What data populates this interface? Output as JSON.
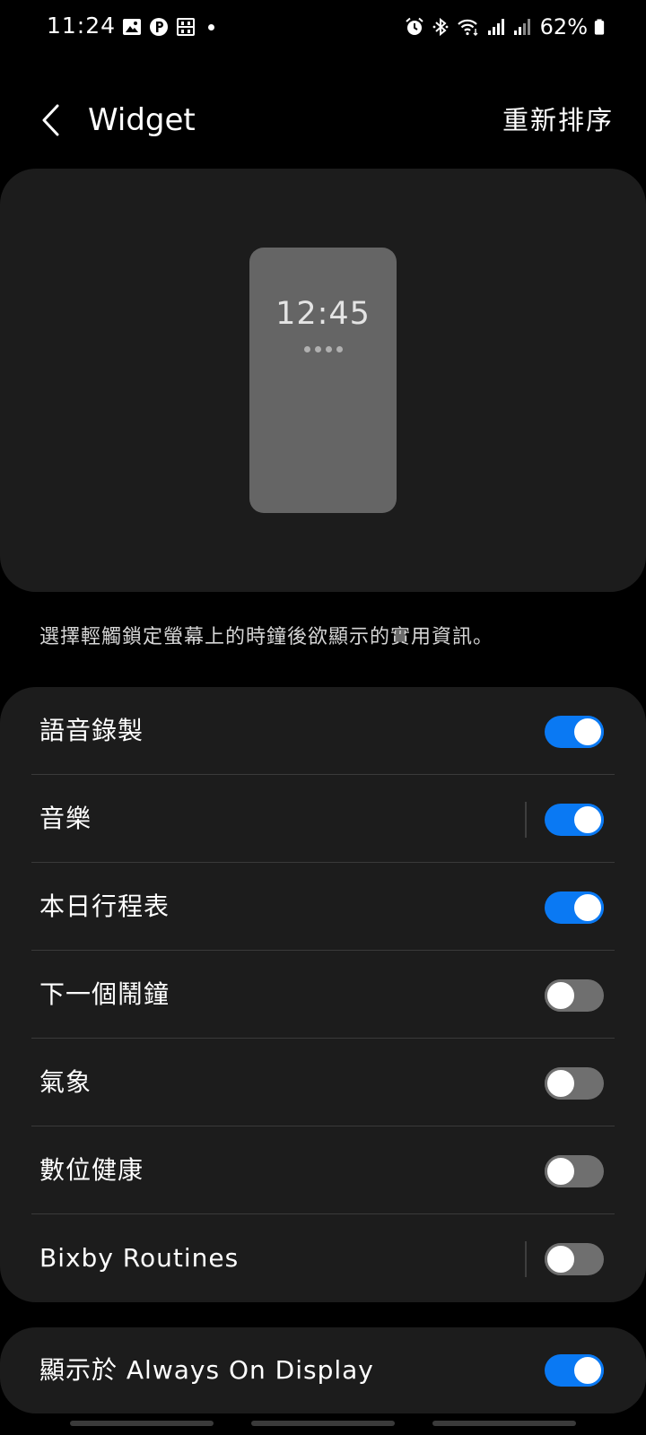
{
  "status_bar": {
    "time": "11:24",
    "left_icons": [
      "image-icon",
      "parking-p-icon",
      "momo-app-icon"
    ],
    "right_icons": [
      "alarm-icon",
      "bluetooth-icon",
      "wifi-icon",
      "signal-icon",
      "signal-icon-2"
    ],
    "battery": "62%"
  },
  "header": {
    "title": "Widget",
    "reorder_label": "重新排序"
  },
  "preview": {
    "clock": "12:45"
  },
  "description": "選擇輕觸鎖定螢幕上的時鐘後欲顯示的實用資訊。",
  "settings": {
    "items": [
      {
        "label": "語音錄製",
        "enabled": true,
        "separator": false
      },
      {
        "label": "音樂",
        "enabled": true,
        "separator": true
      },
      {
        "label": "本日行程表",
        "enabled": true,
        "separator": false
      },
      {
        "label": "下一個鬧鐘",
        "enabled": false,
        "separator": false
      },
      {
        "label": "氣象",
        "enabled": false,
        "separator": false
      },
      {
        "label": "數位健康",
        "enabled": false,
        "separator": false
      },
      {
        "label": "Bixby Routines",
        "enabled": false,
        "separator": true
      }
    ]
  },
  "aod": {
    "label": "顯示於 Always On Display",
    "enabled": true
  },
  "colors": {
    "accent": "#0a79f3",
    "card": "#1c1c1c",
    "background": "#000000"
  }
}
